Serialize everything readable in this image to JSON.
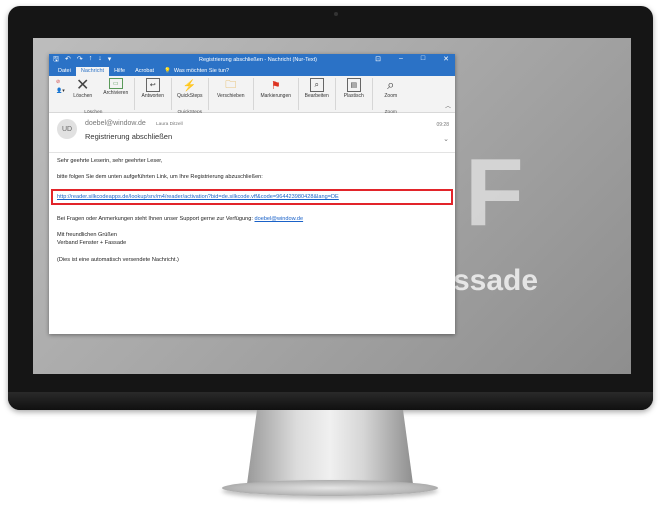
{
  "window": {
    "title": "Registrierung abschließen  -  Nachricht (Nur-Text)",
    "quick_access": [
      "↑",
      "↓"
    ]
  },
  "tabs": [
    {
      "label": "Datei"
    },
    {
      "label": "Nachricht"
    },
    {
      "label": "Hilfe"
    },
    {
      "label": "Acrobat"
    }
  ],
  "tell_me": "Was möchten Sie tun?",
  "ribbon": {
    "delete_group": {
      "label": "Löschen",
      "delete": "Löschen",
      "archive": "Archivieren"
    },
    "respond": {
      "label": "Antworten"
    },
    "quicksteps": {
      "label": "QuickSteps",
      "group": "QuickSteps"
    },
    "move": {
      "label": "Verschieben"
    },
    "tags": {
      "label": "Markierungen"
    },
    "editing": {
      "label": "Bearbeiten"
    },
    "immersive": {
      "label": "Plastisch"
    },
    "zoom": {
      "label": "Zoom",
      "group": "Zoom"
    }
  },
  "message": {
    "avatar_initials": "UD",
    "sender": "doebel@window.de",
    "recipient": "Laura Ditzell",
    "subject": "Registrierung abschließen",
    "time": "09:28",
    "greeting": "Sehr geehrte Leserin, sehr geehrter Leser,",
    "instruction": "bitte folgen Sie dem unten aufgeführten Link, um Ihre Registrierung abzuschließen:",
    "link": "http://reader.silkcodeapps.de/lookup/srv/m4/reader/activation?bid=de.silkcode.vff&code=964423980428&lang=DE",
    "support_text": "Bei Fragen oder Anmerkungen steht Ihnen unser Support gerne zur Verfügung:",
    "support_email": "doebel@window.de",
    "closing": "Mit freundlichen Grüßen",
    "signature": "Verband Fenster + Fassade",
    "auto_note": "(Dies ist eine automatisch versendete Nachricht.)"
  },
  "background": {
    "logo": "F",
    "tagline": "ssade"
  },
  "colors": {
    "accent": "#2b72c6",
    "highlight": "#e2242a",
    "link": "#1a62c8"
  }
}
